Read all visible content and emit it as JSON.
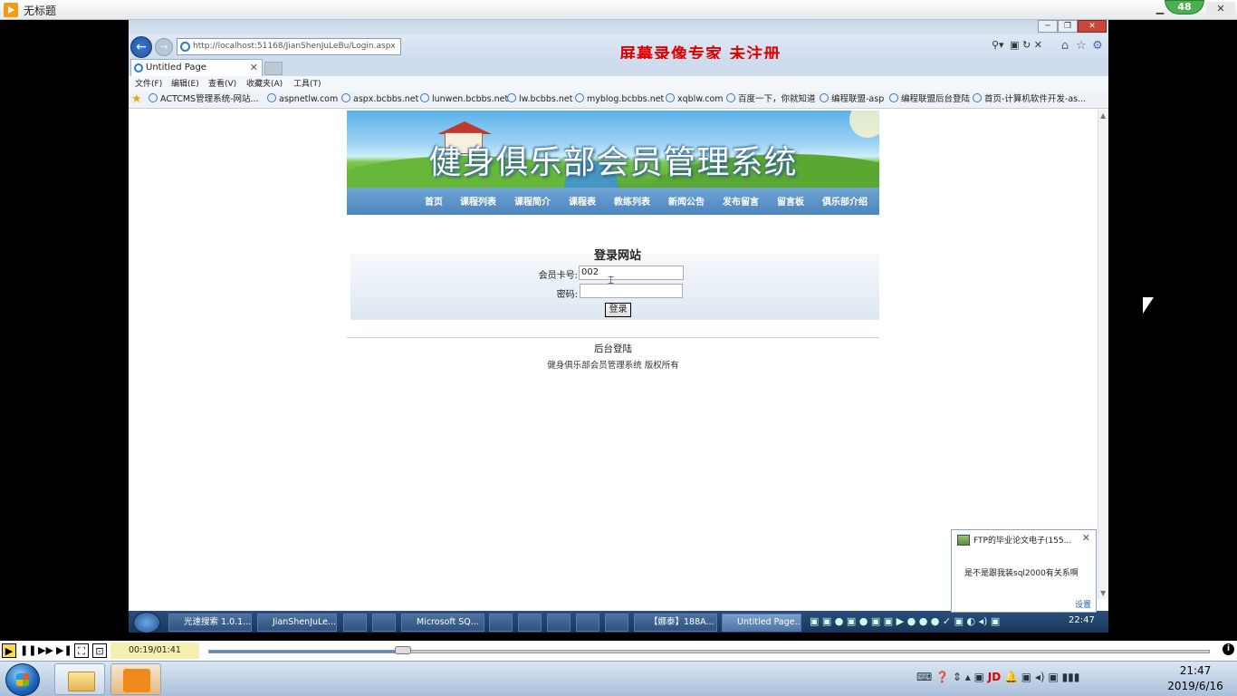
{
  "outer_window": {
    "title": "无标题",
    "badge": "48"
  },
  "browser": {
    "url": "http://localhost:51168/JianShenJuLeBu/Login.aspx",
    "watermark": "屏幕录像专家  未注册",
    "tab_title": "Untitled Page",
    "menu": [
      "文件(F)",
      "编辑(E)",
      "查看(V)",
      "收藏夹(A)",
      "工具(T)"
    ],
    "favorites": [
      "ACTCMS管理系统-网站...",
      "aspnetlw.com",
      "aspx.bcbbs.net",
      "lunwen.bcbbs.net",
      "lw.bcbbs.net",
      "myblog.bcbbs.net",
      "xqblw.com",
      "百度一下，你就知道",
      "编程联盟-asp",
      "编程联盟后台登陆",
      "首页-计算机软件开发-as..."
    ]
  },
  "page": {
    "banner_title": "健身俱乐部会员管理系统",
    "nav": [
      "首页",
      "课程列表",
      "课程简介",
      "课程表",
      "教练列表",
      "新闻公告",
      "发布留言",
      "留言板",
      "俱乐部介绍"
    ],
    "login": {
      "title": "登录网站",
      "card_label": "会员卡号:",
      "card_value": "002",
      "password_label": "密码:",
      "password_value": "",
      "submit_label": "登录"
    },
    "admin_link": "后台登陆",
    "copyright": "健身俱乐部会员管理系统  版权所有"
  },
  "inner_taskbar": {
    "tasks": [
      "光速搜索 1.0.1...",
      "JianShenJuLe...",
      "Microsoft SQ...",
      "【娜泰】188A...",
      "Untitled Page..."
    ],
    "clock": "22:47"
  },
  "notification": {
    "title": "FTP的毕业论文电子(155...",
    "body": "是不是跟我装sql2000有关系啊",
    "settings": "设置"
  },
  "player": {
    "time": "00:19/01:41",
    "progress": 0.19
  },
  "windows_taskbar": {
    "time": "21:47",
    "date": "2019/6/16"
  }
}
